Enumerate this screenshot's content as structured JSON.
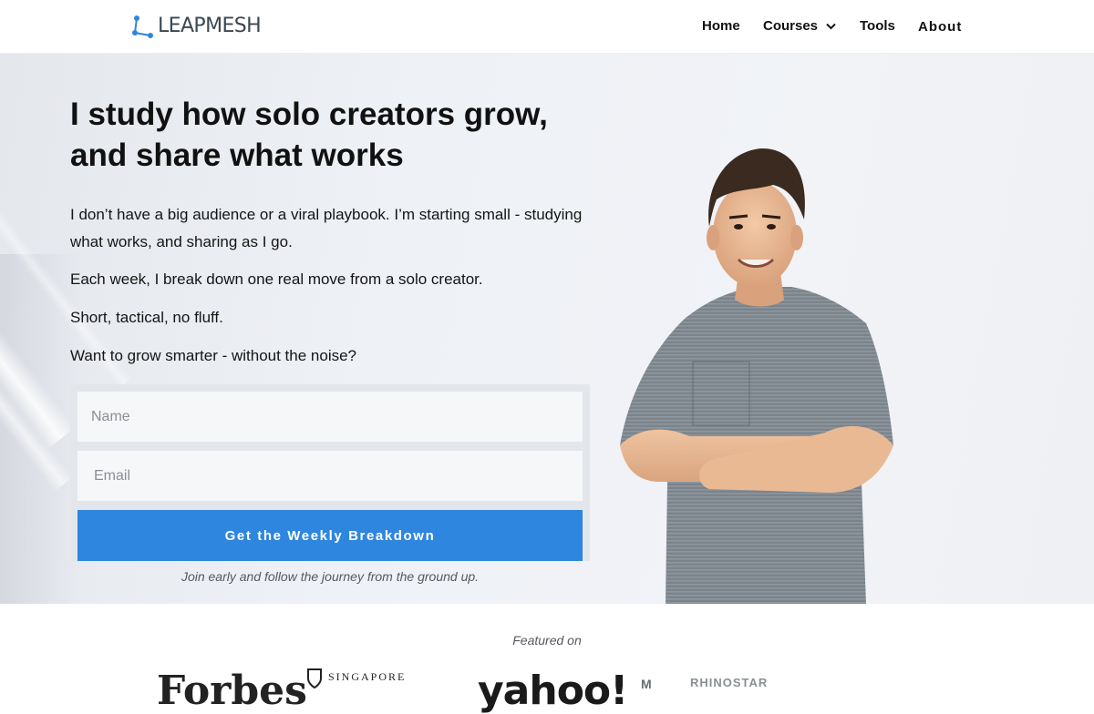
{
  "header": {
    "logo_text": "LEAPMESH",
    "logo_icon": "network-nodes-icon",
    "accent_color": "#2e86de",
    "nav": {
      "home": "Home",
      "courses": "Courses",
      "tools": "Tools",
      "about": "About"
    }
  },
  "hero": {
    "headline_line1": "I study how solo creators grow,",
    "headline_line2": "and share what works",
    "paragraphs": [
      "I don’t have a big audience or a viral playbook. I’m starting small - studying what works, and sharing as I go.",
      "Each week, I break down one real move from a solo creator.",
      "Short, tactical, no fluff.",
      "Want to grow smarter - without the noise?"
    ],
    "form": {
      "name_placeholder": "Name",
      "email_placeholder": "Email",
      "button_label": "Get the Weekly Breakdown",
      "button_color": "#2e86de"
    },
    "note": "Join early and follow the journey from the ground up."
  },
  "featured": {
    "label": "Featured on",
    "logos": {
      "forbes": "Forbes",
      "singapore": "SINGAPORE",
      "yahoo": "yahoo!",
      "m": "M",
      "rhino": "RHINOSTAR"
    }
  }
}
